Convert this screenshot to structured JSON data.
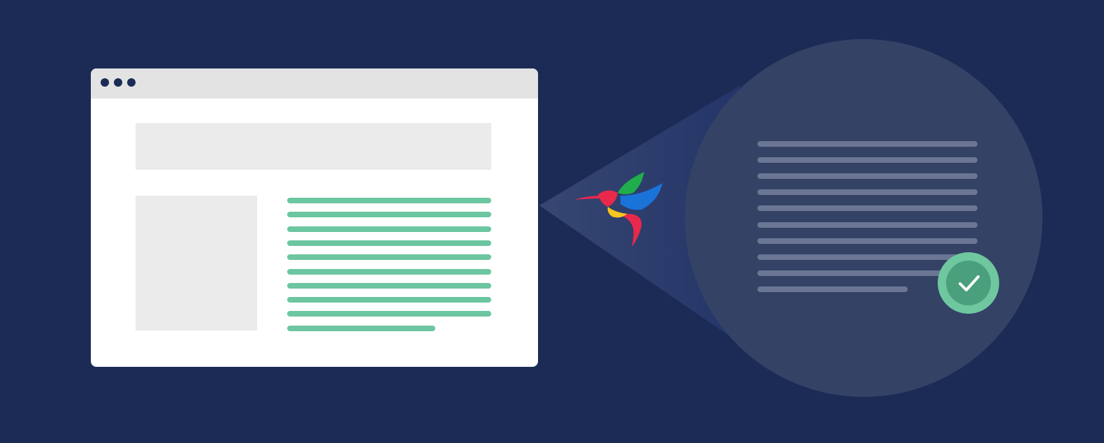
{
  "illustration": {
    "background_color": "#1b2b56",
    "browser_window": {
      "frame_color": "#ffffff",
      "titlebar_color": "#e3e3e3",
      "titlebar_dots": 3,
      "content_placeholder_color": "#ebebeb",
      "highlighted_text_lines": 10,
      "text_line_color": "#6cc6a0"
    },
    "magnifier": {
      "circle_color": "#344266",
      "text_lines": 10,
      "text_line_color": "#6b7694",
      "badge": {
        "icon": "checkmark-icon",
        "outer_color": "#6fc79f",
        "inner_color": "#4a9f7c"
      }
    },
    "logo": {
      "icon": "hummingbird-logo",
      "colors": [
        "#e8294b",
        "#1fae4b",
        "#1a73d9",
        "#f7c51e"
      ]
    }
  }
}
